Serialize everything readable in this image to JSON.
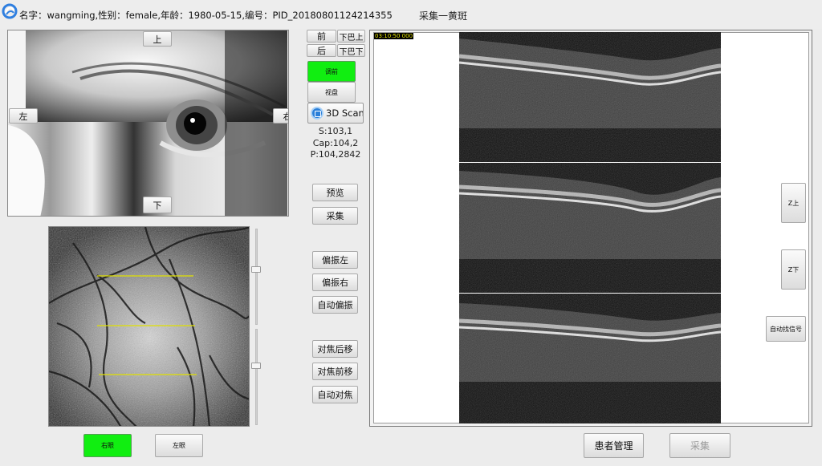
{
  "titlebar": {
    "patient_info": "名字：wangming,性别：female,年龄：1980-05-15,编号：PID_20180801124214355",
    "window_title": "采集一黄斑"
  },
  "camera": {
    "up_label": "上",
    "down_label": "下",
    "left_label": "左",
    "right_label": "右"
  },
  "head_controls": {
    "forward_label": "前",
    "back_label": "后",
    "chin_up_label": "下巴上",
    "chin_down_label": "下巴下"
  },
  "view_buttons": {
    "active_label": "调前",
    "secondary_label": "视盘"
  },
  "scan_mode": {
    "selected": "3D Scan"
  },
  "counters": {
    "s": "S:103,1",
    "cap": "Cap:104,2",
    "p": "P:104,2842"
  },
  "actions": {
    "preview": "预览",
    "capture": "采集",
    "polarize_left": "偏振左",
    "polarize_right": "偏振右",
    "auto_polarize": "自动偏振",
    "focus_back": "对焦后移",
    "focus_forward": "对焦前移",
    "auto_focus": "自动对焦"
  },
  "eye_select": {
    "right_eye": "右眼",
    "left_eye": "左眼"
  },
  "oct": {
    "overlay_text": "03:10:50 000",
    "z_up": "Z上",
    "z_down": "Z下",
    "auto_signal": "自动找信号"
  },
  "bottom": {
    "patient_manage": "患者管理",
    "capture": "采集"
  },
  "colors": {
    "active_green": "#11ee11",
    "scan_line_yellow": "#e0e000"
  },
  "icons": {
    "app": "app-logo-icon",
    "scan_mode": "scan-mode-icon",
    "dropdown": "dropdown-arrow-icon"
  }
}
